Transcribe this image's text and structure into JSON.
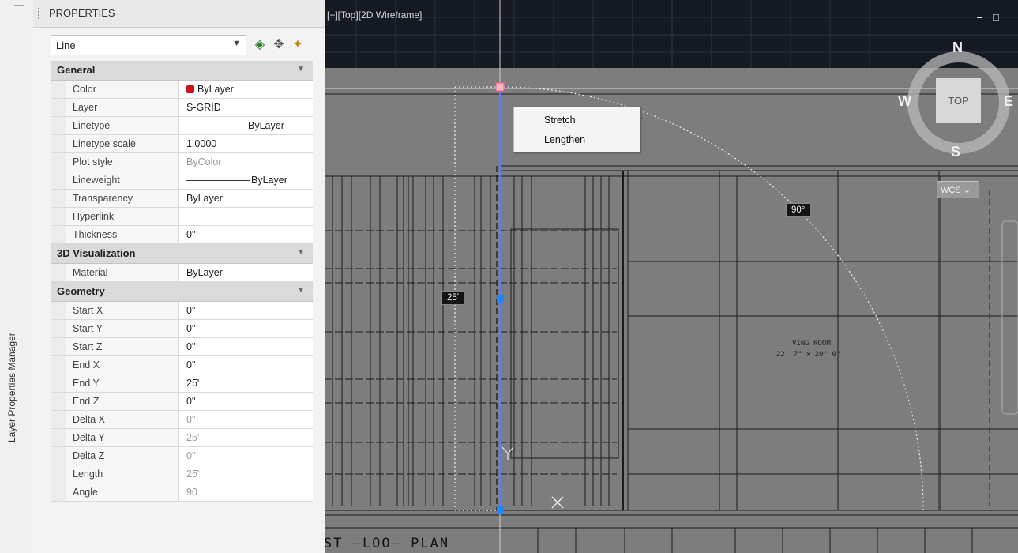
{
  "left_rail": {
    "label": "Layer Properties Manager"
  },
  "properties": {
    "title": "PROPERTIES",
    "object_type": "Line",
    "sections": [
      {
        "name": "General",
        "rows": [
          {
            "label": "Color",
            "value": "ByLayer",
            "color_swatch": "#d0101a"
          },
          {
            "label": "Layer",
            "value": "S-GRID"
          },
          {
            "label": "Linetype",
            "value": "ByLayer",
            "linetype_preview": "dashed"
          },
          {
            "label": "Linetype scale",
            "value": "1.0000"
          },
          {
            "label": "Plot style",
            "value": "ByColor",
            "disabled": true
          },
          {
            "label": "Lineweight",
            "value": "ByLayer"
          },
          {
            "label": "Transparency",
            "value": "ByLayer"
          },
          {
            "label": "Hyperlink",
            "value": ""
          },
          {
            "label": "Thickness",
            "value": "0\""
          }
        ]
      },
      {
        "name": "3D Visualization",
        "rows": [
          {
            "label": "Material",
            "value": "ByLayer"
          }
        ]
      },
      {
        "name": "Geometry",
        "rows": [
          {
            "label": "Start X",
            "value": "0\""
          },
          {
            "label": "Start Y",
            "value": "0\""
          },
          {
            "label": "Start Z",
            "value": "0\""
          },
          {
            "label": "End X",
            "value": "0\""
          },
          {
            "label": "End Y",
            "value": "25'"
          },
          {
            "label": "End Z",
            "value": "0\""
          },
          {
            "label": "Delta X",
            "value": "0\"",
            "disabled": true
          },
          {
            "label": "Delta Y",
            "value": "25'",
            "disabled": true
          },
          {
            "label": "Delta Z",
            "value": "0\"",
            "disabled": true
          },
          {
            "label": "Length",
            "value": "25'",
            "disabled": true
          },
          {
            "label": "Angle",
            "value": "90",
            "disabled": true
          }
        ]
      }
    ]
  },
  "viewport": {
    "label": "[−][Top][2D Wireframe]",
    "window_controls": {
      "minimize": "–",
      "restore": "□"
    },
    "context_menu": {
      "items": [
        "Stretch",
        "Lengthen"
      ]
    },
    "dimension_tags": {
      "length": "25'",
      "angle": "90°"
    },
    "viewcube": {
      "north": "N",
      "south": "S",
      "east": "E",
      "west": "W",
      "face": "TOP",
      "ucs": "WCS"
    },
    "room_label": {
      "name": "VING ROOM",
      "size": "22' 7\" x 20' 0\""
    },
    "plan_title": "ST  –LOO–  PLAN"
  }
}
